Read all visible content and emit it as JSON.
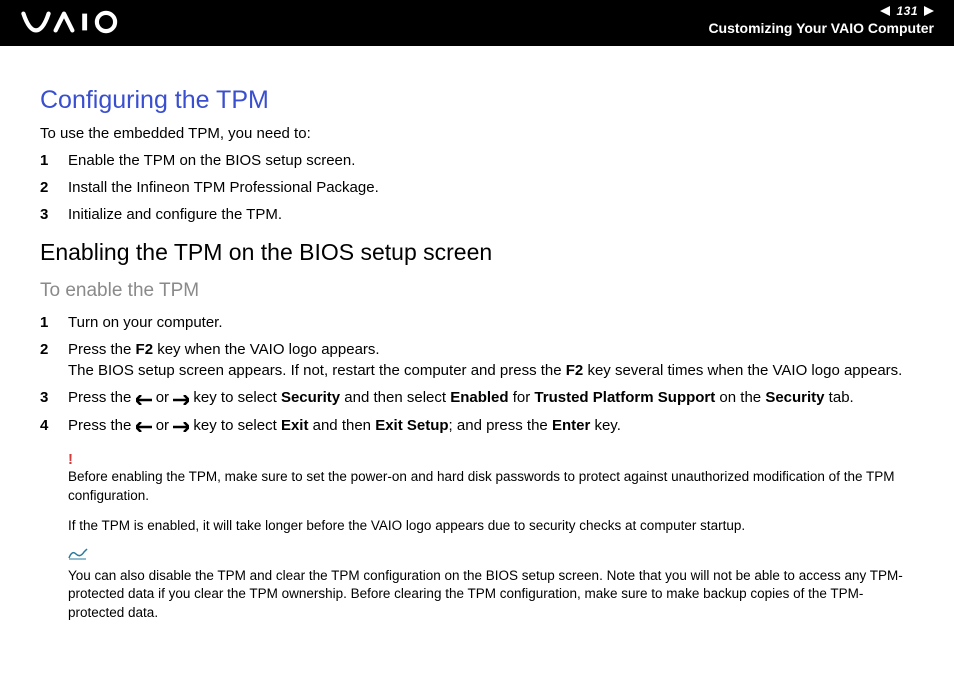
{
  "header": {
    "page_number": "131",
    "section": "Customizing Your VAIO Computer"
  },
  "title": "Configuring the TPM",
  "intro": "To use the embedded TPM, you need to:",
  "overview_steps": [
    "Enable the TPM on the BIOS setup screen.",
    "Install the Infineon TPM Professional Package.",
    "Initialize and configure the TPM."
  ],
  "heading2": "Enabling the TPM on the BIOS setup screen",
  "heading3": "To enable the TPM",
  "enable_steps": {
    "s1": "Turn on your computer.",
    "s2_a": "Press the ",
    "s2_b": "F2",
    "s2_c": " key when the VAIO logo appears.",
    "s2_d": "The BIOS setup screen appears. If not, restart the computer and press the ",
    "s2_e": "F2",
    "s2_f": " key several times when the VAIO logo appears.",
    "s3_a": "Press the ",
    "s3_b": " or ",
    "s3_c": " key to select ",
    "s3_d": "Security",
    "s3_e": " and then select ",
    "s3_f": "Enabled",
    "s3_g": " for ",
    "s3_h": "Trusted Platform Support",
    "s3_i": " on the ",
    "s3_j": "Security",
    "s3_k": " tab.",
    "s4_a": "Press the ",
    "s4_b": " or ",
    "s4_c": " key to select ",
    "s4_d": "Exit",
    "s4_e": " and then ",
    "s4_f": "Exit Setup",
    "s4_g": "; and press the ",
    "s4_h": "Enter",
    "s4_i": " key."
  },
  "warn_icon": "!",
  "warn1": "Before enabling the TPM, make sure to set the power-on and hard disk passwords to protect against unauthorized modification of the TPM configuration.",
  "warn2": "If the TPM is enabled, it will take longer before the VAIO logo appears due to security checks at computer startup.",
  "tip": "You can also disable the TPM and clear the TPM configuration on the BIOS setup screen. Note that you will not be able to access any TPM-protected data if you clear the TPM ownership. Before clearing the TPM configuration, make sure to make backup copies of the TPM-protected data."
}
